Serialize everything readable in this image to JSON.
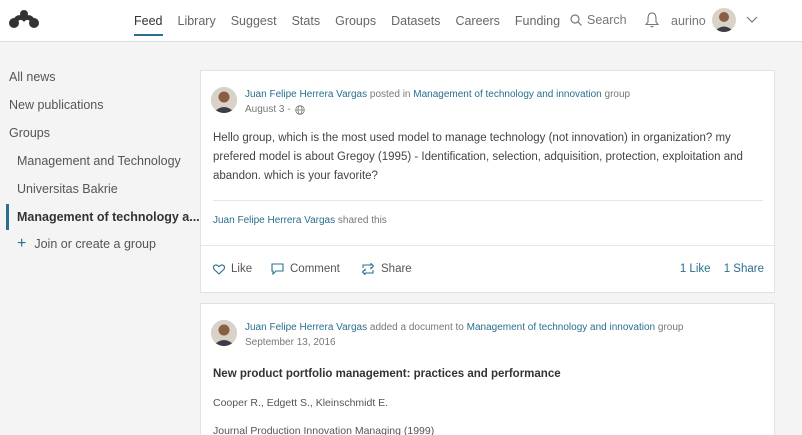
{
  "nav": {
    "items": [
      "Feed",
      "Library",
      "Suggest",
      "Stats",
      "Groups",
      "Datasets",
      "Careers",
      "Funding"
    ],
    "active": "Feed",
    "search_label": "Search",
    "username": "aurino"
  },
  "sidebar": {
    "items": [
      "All news",
      "New publications",
      "Groups",
      "Management and Technology",
      "Universitas Bakrie",
      "Management of technology a...",
      "Join or create a group"
    ]
  },
  "post1": {
    "author": "Juan Felipe Herrera Vargas",
    "verb": "posted in",
    "group": "Management of technology and innovation",
    "group_suffix": "group",
    "date": "August 3 -",
    "body": "Hello group, which is the most used model to manage technology (not innovation) in organization? my prefered model is about Gregoy (1995) - Identification, selection, adquisition, protection, exploitation and abandon. which is your favorite?",
    "shared_by": "Juan Felipe Herrera Vargas",
    "shared_suffix": "shared this",
    "like_label": "Like",
    "comment_label": "Comment",
    "share_label": "Share",
    "likes_count": "1 Like",
    "shares_count": "1 Share"
  },
  "post2": {
    "author": "Juan Felipe Herrera Vargas",
    "verb": "added a document to",
    "group": "Management of technology and innovation",
    "group_suffix": "group",
    "date": "September 13, 2016",
    "doc_title": "New product portfolio management: practices and performance",
    "doc_authors": "Cooper R., Edgett S., Kleinschmidt E.",
    "doc_journal": "Journal Production Innovation Managing (1999)"
  },
  "colors": {
    "accent": "#2a6f8f",
    "background": "#f4f4f4"
  }
}
